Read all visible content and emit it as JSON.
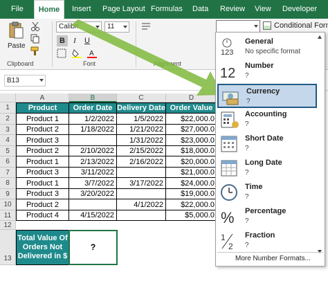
{
  "tabs": [
    {
      "label": "File"
    },
    {
      "label": "Home"
    },
    {
      "label": "Insert"
    },
    {
      "label": "Page Layout"
    },
    {
      "label": "Formulas"
    },
    {
      "label": "Data"
    },
    {
      "label": "Review"
    },
    {
      "label": "View"
    },
    {
      "label": "Developer"
    }
  ],
  "ribbon": {
    "paste_label": "Paste",
    "clipboard_label": "Clipboard",
    "font_label": "Font",
    "alignment_label": "Alignment",
    "font_name": "Calibri",
    "font_size": "11",
    "bold": "B",
    "italic": "I",
    "underline": "U",
    "conditional_formatting": "Conditional Forma"
  },
  "name_box": "B13",
  "columns": [
    "A",
    "B",
    "C",
    "D"
  ],
  "rows": [
    "1",
    "2",
    "3",
    "4",
    "5",
    "6",
    "7",
    "8",
    "9",
    "10",
    "11",
    "12",
    "13"
  ],
  "table": {
    "headers": [
      "Product",
      "Order Date",
      "Delivery Date",
      "Order Value"
    ],
    "rows": [
      [
        "Product 1",
        "1/2/2022",
        "1/5/2022",
        "$22,000.0"
      ],
      [
        "Product 2",
        "1/18/2022",
        "1/21/2022",
        "$27,000.0"
      ],
      [
        "Product 3",
        "",
        "1/31/2022",
        "$23,000.0"
      ],
      [
        "Product 2",
        "2/10/2022",
        "2/15/2022",
        "$18,000.0"
      ],
      [
        "Product 1",
        "2/13/2022",
        "2/16/2022",
        "$20,000.0"
      ],
      [
        "Product 3",
        "3/11/2022",
        "",
        "$21,000.0"
      ],
      [
        "Product 1",
        "3/7/2022",
        "3/17/2022",
        "$24,000.0"
      ],
      [
        "Product 3",
        "3/20/2022",
        "",
        "$19,000.0"
      ],
      [
        "Product 2",
        "",
        "4/1/2022",
        "$22,000.0"
      ],
      [
        "Product 4",
        "4/15/2022",
        "",
        "$5,000.0"
      ]
    ]
  },
  "total": {
    "label_line1": "Total Value Of",
    "label_line2": "Orders Not",
    "label_line3": "Delivered in $",
    "value": "?"
  },
  "number_formats": [
    {
      "title": "General",
      "sub": "No specific format",
      "icon": "general-123-icon"
    },
    {
      "title": "Number",
      "sub": "?",
      "icon": "number-12-icon"
    },
    {
      "title": "Currency",
      "sub": "?",
      "icon": "currency-icon",
      "selected": true
    },
    {
      "title": "Accounting",
      "sub": "?",
      "icon": "accounting-icon"
    },
    {
      "title": "Short Date",
      "sub": "?",
      "icon": "short-date-calendar-icon"
    },
    {
      "title": "Long Date",
      "sub": "?",
      "icon": "long-date-calendar-icon"
    },
    {
      "title": "Time",
      "sub": "?",
      "icon": "clock-icon"
    },
    {
      "title": "Percentage",
      "sub": "?",
      "icon": "percent-icon"
    },
    {
      "title": "Fraction",
      "sub": "?",
      "icon": "fraction-icon"
    }
  ],
  "more_formats": "More Number Formats...",
  "colors": {
    "excel_green": "#217346",
    "header_teal": "#1f8a8c",
    "arrow_green": "#7fb83b",
    "selected_item": "#c5d7ea"
  }
}
